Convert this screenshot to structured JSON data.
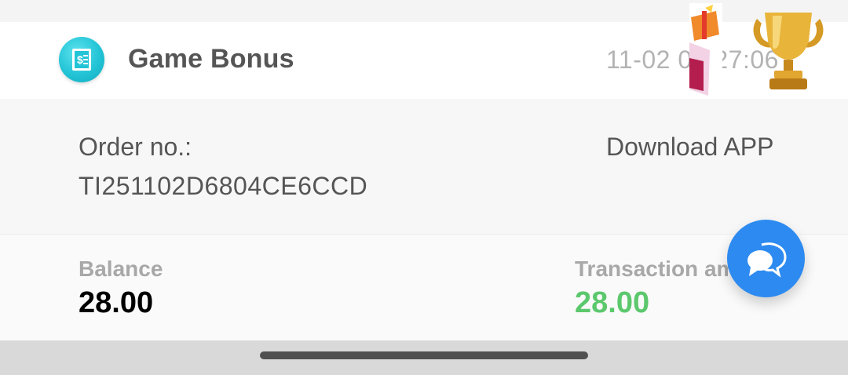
{
  "header": {
    "title": "Game Bonus",
    "time": "11-02 09:27:06",
    "icon": "receipt-dollar-icon"
  },
  "order": {
    "label": "Order no.:",
    "value": "TI251102D6804CE6CCD",
    "type": "Download APP"
  },
  "stats": {
    "balance_label": "Balance",
    "balance_value": "28.00",
    "transaction_label": "Transaction amount",
    "transaction_value": "28.00"
  },
  "colors": {
    "accent_teal": "#22c4d6",
    "amount_green": "#5cc86d",
    "fab_blue": "#2d8af0"
  },
  "icons": {
    "chat": "chat-bubbles-icon",
    "gift": "gift-icon",
    "trophy": "trophy-icon"
  }
}
